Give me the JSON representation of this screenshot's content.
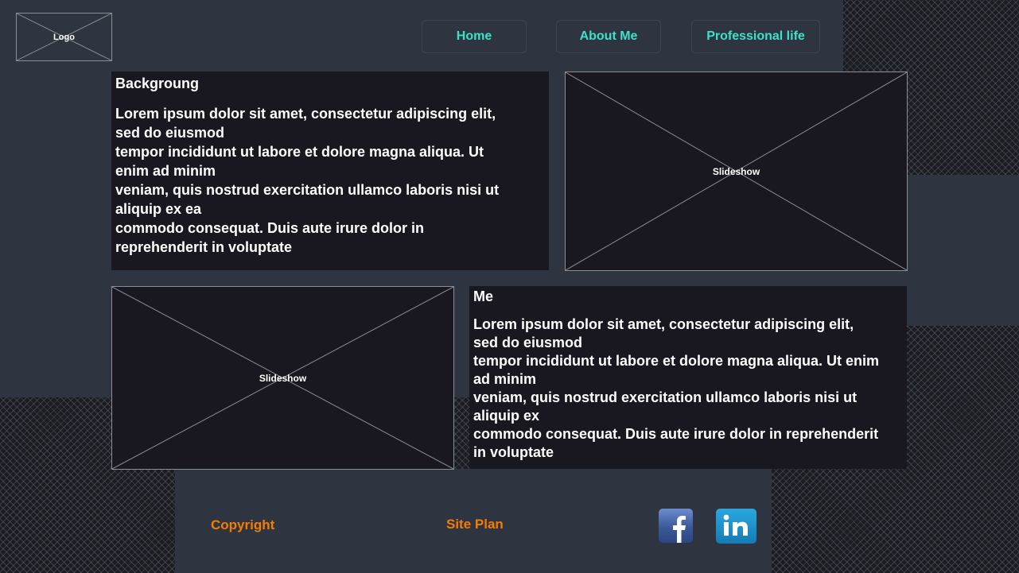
{
  "header": {
    "logo_label": "Logo",
    "nav": [
      "Home",
      "About Me",
      "Professional life"
    ]
  },
  "background_section": {
    "heading": "Backgroung",
    "lines": [
      "Lorem ipsum dolor sit amet, consectetur adipiscing elit,",
      "sed do eiusmod",
      "tempor incididunt ut labore et dolore magna aliqua. Ut",
      "enim ad minim",
      "veniam, quis nostrud exercitation ullamco laboris nisi ut",
      "aliquip ex ea",
      "commodo consequat. Duis aute irure dolor in",
      "reprehenderit in voluptate"
    ]
  },
  "slideshow_top": {
    "label": "Slideshow"
  },
  "slideshow_bottom": {
    "label": "Slideshow"
  },
  "me_section": {
    "heading": "Me",
    "lines": [
      "Lorem ipsum dolor sit amet, consectetur adipiscing elit,",
      "sed do eiusmod",
      "tempor incididunt ut labore et dolore magna aliqua. Ut enim",
      "ad minim",
      "veniam, quis nostrud exercitation ullamco laboris nisi ut",
      "aliquip ex",
      "commodo consequat. Duis aute irure dolor in reprehenderit",
      "in voluptate"
    ]
  },
  "footer": {
    "copyright": "Copyright",
    "site_plan": "Site Plan",
    "social": [
      {
        "icon": "facebook-icon",
        "glyph": "f",
        "color": "#3b5998"
      },
      {
        "icon": "linkedin-icon",
        "glyph": "in",
        "color": "#1d8ec8"
      }
    ]
  },
  "colors": {
    "nav_text": "#3de0c8",
    "footer_text": "#f57c00",
    "panel_bg": "#19171f",
    "slate_bg": "#2e3541"
  }
}
